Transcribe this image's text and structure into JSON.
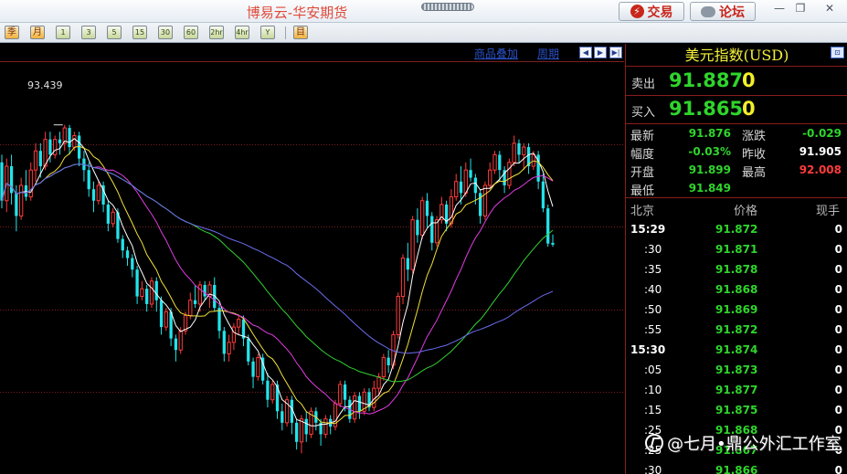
{
  "window": {
    "title": "博易云-华安期货",
    "trade_label": "交易",
    "forum_label": "论坛"
  },
  "toolbar": {
    "tools": [
      "季",
      "月",
      "1",
      "3",
      "5",
      "15",
      "30",
      "60",
      "2hr",
      "4hr",
      "Y",
      "目"
    ]
  },
  "chart": {
    "overlay_link": "商品叠加",
    "period_link": "周期",
    "peak_label": "93.439",
    "colors": {
      "up": "#ff3b3b",
      "down": "#23e3ea",
      "ma5": "#ffffff",
      "ma10": "#f1e23a",
      "ma20": "#e03ce0",
      "ma40": "#32d232",
      "ma60": "#6c6cf0",
      "grid": "#7d1f1f"
    }
  },
  "chart_data": {
    "type": "candlestick",
    "ylim": [
      89.0,
      94.2
    ],
    "candles": [
      [
        92.95,
        92.45,
        93.05,
        92.35
      ],
      [
        92.45,
        92.9,
        93.0,
        92.3
      ],
      [
        92.9,
        92.55,
        93.05,
        92.4
      ],
      [
        92.55,
        92.25,
        92.65,
        92.05
      ],
      [
        92.25,
        92.65,
        92.75,
        92.2
      ],
      [
        92.65,
        92.5,
        92.85,
        92.45
      ],
      [
        92.5,
        92.85,
        92.95,
        92.45
      ],
      [
        92.85,
        93.1,
        93.2,
        92.7
      ],
      [
        93.1,
        92.9,
        93.2,
        92.75
      ],
      [
        92.9,
        93.25,
        93.35,
        92.85
      ],
      [
        93.25,
        93.05,
        93.35,
        92.95
      ],
      [
        93.05,
        93.25,
        93.3,
        93.0
      ],
      [
        93.25,
        93.2,
        93.35,
        93.05
      ],
      [
        93.2,
        93.4,
        93.44,
        93.1
      ],
      [
        93.4,
        93.15,
        93.44,
        93.05
      ],
      [
        93.15,
        93.3,
        93.35,
        93.1
      ],
      [
        93.3,
        93.0,
        93.35,
        92.9
      ],
      [
        93.0,
        92.85,
        93.1,
        92.7
      ],
      [
        92.85,
        92.6,
        92.95,
        92.5
      ],
      [
        92.6,
        92.45,
        92.7,
        92.3
      ],
      [
        92.45,
        92.65,
        92.7,
        92.4
      ],
      [
        92.65,
        92.4,
        92.7,
        92.3
      ],
      [
        92.4,
        92.15,
        92.45,
        92.05
      ],
      [
        92.15,
        92.3,
        92.35,
        92.1
      ],
      [
        92.3,
        91.95,
        92.35,
        91.9
      ],
      [
        91.95,
        91.8,
        92.0,
        91.7
      ],
      [
        91.8,
        91.7,
        91.85,
        91.6
      ],
      [
        91.7,
        91.55,
        91.75,
        91.45
      ],
      [
        91.55,
        91.2,
        91.6,
        91.1
      ],
      [
        91.2,
        91.3,
        91.4,
        91.15
      ],
      [
        91.3,
        91.1,
        91.35,
        91.0
      ],
      [
        91.1,
        91.4,
        91.45,
        91.05
      ],
      [
        91.4,
        91.15,
        91.45,
        91.0
      ],
      [
        91.15,
        90.8,
        91.2,
        90.7
      ],
      [
        90.8,
        91.0,
        91.05,
        90.75
      ],
      [
        91.0,
        90.65,
        91.05,
        90.55
      ],
      [
        90.65,
        90.5,
        90.7,
        90.35
      ],
      [
        90.5,
        90.75,
        90.8,
        90.45
      ],
      [
        90.75,
        90.95,
        91.0,
        90.7
      ],
      [
        90.95,
        91.15,
        91.25,
        90.9
      ],
      [
        91.15,
        91.1,
        91.35,
        91.05
      ],
      [
        91.1,
        91.35,
        91.4,
        91.0
      ],
      [
        91.35,
        91.2,
        91.4,
        91.15
      ],
      [
        91.2,
        91.35,
        91.4,
        91.05
      ],
      [
        91.35,
        91.05,
        91.45,
        91.0
      ],
      [
        91.05,
        90.75,
        91.1,
        90.65
      ],
      [
        90.75,
        90.45,
        90.8,
        90.35
      ],
      [
        90.45,
        90.6,
        90.7,
        90.35
      ],
      [
        90.6,
        90.8,
        90.85,
        90.5
      ],
      [
        90.8,
        90.9,
        90.95,
        90.7
      ],
      [
        90.9,
        90.65,
        90.95,
        90.55
      ],
      [
        90.65,
        90.35,
        90.7,
        90.3
      ],
      [
        90.35,
        90.15,
        90.4,
        90.0
      ],
      [
        90.15,
        90.4,
        90.45,
        90.1
      ],
      [
        90.4,
        90.1,
        90.45,
        90.05
      ],
      [
        90.1,
        89.85,
        90.2,
        89.75
      ],
      [
        89.85,
        90.05,
        90.1,
        89.8
      ],
      [
        90.05,
        89.7,
        90.1,
        89.6
      ],
      [
        89.7,
        89.55,
        89.8,
        89.45
      ],
      [
        89.55,
        89.85,
        89.9,
        89.5
      ],
      [
        89.85,
        89.55,
        89.9,
        89.4
      ],
      [
        89.55,
        89.3,
        89.6,
        89.2
      ],
      [
        89.3,
        89.6,
        89.65,
        89.15
      ],
      [
        89.6,
        89.4,
        89.7,
        89.3
      ],
      [
        89.4,
        89.7,
        89.75,
        89.35
      ],
      [
        89.7,
        89.55,
        89.75,
        89.45
      ],
      [
        89.55,
        89.4,
        89.6,
        89.25
      ],
      [
        89.4,
        89.6,
        89.65,
        89.35
      ],
      [
        89.6,
        89.5,
        89.65,
        89.4
      ],
      [
        89.5,
        89.8,
        89.85,
        89.45
      ],
      [
        89.8,
        90.05,
        90.1,
        89.75
      ],
      [
        90.05,
        89.85,
        90.1,
        89.7
      ],
      [
        89.85,
        89.6,
        89.9,
        89.55
      ],
      [
        89.6,
        89.9,
        89.95,
        89.55
      ],
      [
        89.9,
        89.7,
        89.95,
        89.6
      ],
      [
        89.7,
        89.95,
        90.0,
        89.65
      ],
      [
        89.95,
        89.75,
        90.0,
        89.7
      ],
      [
        89.75,
        90.0,
        90.1,
        89.7
      ],
      [
        90.0,
        90.15,
        90.2,
        89.9
      ],
      [
        90.15,
        90.4,
        90.45,
        90.1
      ],
      [
        90.4,
        90.3,
        90.5,
        90.2
      ],
      [
        90.3,
        90.7,
        90.75,
        90.25
      ],
      [
        90.7,
        91.2,
        91.25,
        90.65
      ],
      [
        91.2,
        91.7,
        91.75,
        91.1
      ],
      [
        91.7,
        91.55,
        91.9,
        91.4
      ],
      [
        91.55,
        92.2,
        92.25,
        91.5
      ],
      [
        92.2,
        92.0,
        92.35,
        91.9
      ],
      [
        92.0,
        92.45,
        92.5,
        91.95
      ],
      [
        92.45,
        92.25,
        92.55,
        92.1
      ],
      [
        92.25,
        91.9,
        92.3,
        91.8
      ],
      [
        91.9,
        92.2,
        92.25,
        91.85
      ],
      [
        92.2,
        92.4,
        92.5,
        92.15
      ],
      [
        92.4,
        92.15,
        92.45,
        92.05
      ],
      [
        92.15,
        92.5,
        92.6,
        92.1
      ],
      [
        92.5,
        92.7,
        92.8,
        92.45
      ],
      [
        92.7,
        92.55,
        92.9,
        92.4
      ],
      [
        92.55,
        92.85,
        92.95,
        92.5
      ],
      [
        92.85,
        92.75,
        93.0,
        92.7
      ],
      [
        92.75,
        92.55,
        92.8,
        92.4
      ],
      [
        92.55,
        92.25,
        92.6,
        92.15
      ],
      [
        92.25,
        92.65,
        92.7,
        92.2
      ],
      [
        92.65,
        92.85,
        92.95,
        92.6
      ],
      [
        92.85,
        93.05,
        93.1,
        92.8
      ],
      [
        93.05,
        92.85,
        93.1,
        92.7
      ],
      [
        92.85,
        92.65,
        92.9,
        92.55
      ],
      [
        92.65,
        92.95,
        93.0,
        92.6
      ],
      [
        92.95,
        93.2,
        93.3,
        92.9
      ],
      [
        93.2,
        93.05,
        93.25,
        92.95
      ],
      [
        93.05,
        93.15,
        93.2,
        92.85
      ],
      [
        93.15,
        92.9,
        93.2,
        92.8
      ],
      [
        92.9,
        93.05,
        93.1,
        92.85
      ],
      [
        93.05,
        92.7,
        93.1,
        92.6
      ],
      [
        92.7,
        92.35,
        92.8,
        92.3
      ],
      [
        92.35,
        91.89,
        92.4,
        91.85
      ],
      [
        91.899,
        91.876,
        92.008,
        91.849
      ]
    ],
    "ma_series": [
      {
        "key": "ma5",
        "period": 5
      },
      {
        "key": "ma10",
        "period": 10
      },
      {
        "key": "ma20",
        "period": 20
      },
      {
        "key": "ma40",
        "period": 40
      },
      {
        "key": "ma60",
        "period": 60
      }
    ]
  },
  "panel": {
    "title": "美元指数(USD)",
    "sell_label": "卖出",
    "sell_price": "91.887",
    "sell_qty": "0",
    "buy_label": "买入",
    "buy_price": "91.865",
    "buy_qty": "0",
    "stats": {
      "latest_label": "最新",
      "latest": "91.876",
      "change_label": "涨跌",
      "change": "-0.029",
      "pct_label": "幅度",
      "pct": "-0.03%",
      "prev_close_label": "昨收",
      "prev_close": "91.905",
      "open_label": "开盘",
      "open": "91.899",
      "high_label": "最高",
      "high": "92.008",
      "low_label": "最低",
      "low": "91.849"
    },
    "ticks_header": {
      "time": "北京",
      "price": "价格",
      "volume": "现手"
    },
    "ticks": [
      {
        "time": "15:29",
        "full": true,
        "price": "91.872",
        "volume": "0"
      },
      {
        "time": ":30",
        "full": false,
        "price": "91.871",
        "volume": "0"
      },
      {
        "time": ":35",
        "full": false,
        "price": "91.878",
        "volume": "0"
      },
      {
        "time": ":40",
        "full": false,
        "price": "91.868",
        "volume": "0"
      },
      {
        "time": ":50",
        "full": false,
        "price": "91.869",
        "volume": "0"
      },
      {
        "time": ":55",
        "full": false,
        "price": "91.872",
        "volume": "0"
      },
      {
        "time": "15:30",
        "full": true,
        "price": "91.874",
        "volume": "0"
      },
      {
        "time": ":05",
        "full": false,
        "price": "91.873",
        "volume": "0"
      },
      {
        "time": ":10",
        "full": false,
        "price": "91.877",
        "volume": "0"
      },
      {
        "time": ":15",
        "full": false,
        "price": "91.875",
        "volume": "0"
      },
      {
        "time": ":25",
        "full": false,
        "price": "91.868",
        "volume": "0"
      },
      {
        "time": ":25",
        "full": false,
        "price": "91.867",
        "volume": "0"
      },
      {
        "time": ":30",
        "full": false,
        "price": "91.866",
        "volume": "0"
      }
    ]
  },
  "watermark": {
    "text": "@七月•鼎公外汇工作室"
  }
}
